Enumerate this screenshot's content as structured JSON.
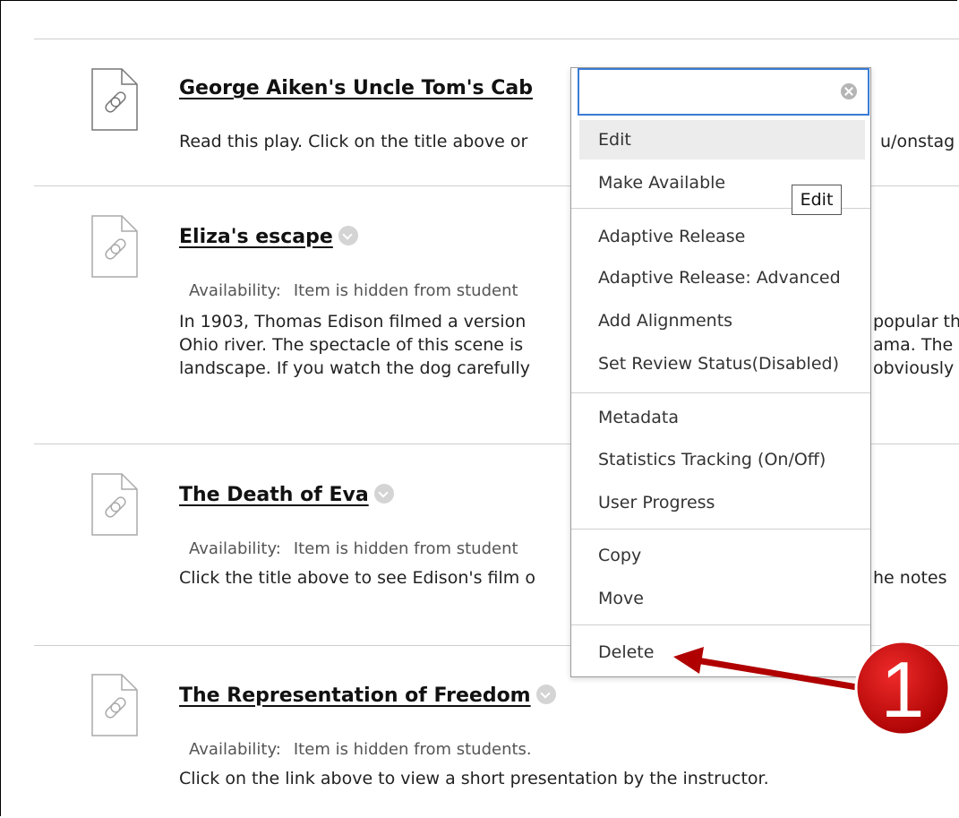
{
  "items": [
    {
      "title": "George Aiken's Uncle Tom's Cab",
      "description_lines": [
        "Read this play.  Click on the title above or",
        "u/onstag"
      ]
    },
    {
      "title": "Eliza's escape",
      "availability_label": "Availability:",
      "availability_value": "Item is hidden from student",
      "description_lines": [
        "In 1903, Thomas Edison filmed a version",
        "Ohio river.  The spectacle of this scene is",
        "landscape.  If you watch the dog carefully"
      ],
      "description_right": [
        "popular th",
        "ama.  The",
        "obviously"
      ]
    },
    {
      "title": "The Death of Eva",
      "availability_label": "Availability:",
      "availability_value": "Item is hidden from student",
      "description_lines": [
        "Click the title above to see Edison's film o"
      ],
      "description_right": [
        "he notes"
      ]
    },
    {
      "title": "The Representation of Freedom",
      "availability_label": "Availability:",
      "availability_value": "Item is hidden from students.",
      "description_lines": [
        "Click on the link above to view a short presentation by the instructor."
      ]
    }
  ],
  "menu": {
    "search_value": "",
    "items": [
      {
        "label": "Edit",
        "highlighted": true
      },
      {
        "label": "Make Available"
      },
      {
        "label": "Adaptive Release"
      },
      {
        "label": "Adaptive Release: Advanced"
      },
      {
        "label": "Add Alignments"
      },
      {
        "label": "Set Review Status(Disabled)"
      },
      {
        "label": "Metadata"
      },
      {
        "label": "Statistics Tracking (On/Off)"
      },
      {
        "label": "User Progress"
      },
      {
        "label": "Copy"
      },
      {
        "label": "Move"
      },
      {
        "label": "Delete"
      }
    ]
  },
  "tooltip": "Edit",
  "callout": {
    "number": "1",
    "color": "#cc0000"
  },
  "icons": {
    "item": "link-document-icon",
    "options": "chevron-down-icon",
    "clear": "clear-icon"
  }
}
